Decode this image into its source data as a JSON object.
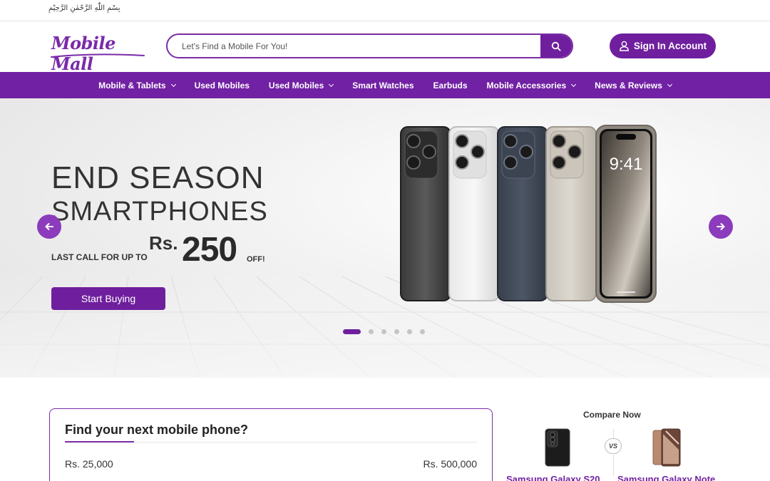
{
  "top_strip": {
    "bismillah": "بِسْمِ اللّٰهِ الرَّحْمٰنِ الرَّحِیْمِ"
  },
  "header": {
    "logo_text": "Mobile Mall",
    "search_placeholder": "Let's Find a Mobile For You!",
    "signin_label": "Sign In Account"
  },
  "nav": {
    "items": [
      {
        "label": "Mobile & Tablets",
        "has_dropdown": true
      },
      {
        "label": "Used Mobiles",
        "has_dropdown": false
      },
      {
        "label": "Used Mobiles",
        "has_dropdown": true
      },
      {
        "label": "Smart Watches",
        "has_dropdown": false
      },
      {
        "label": "Earbuds",
        "has_dropdown": false
      },
      {
        "label": "Mobile Accessories",
        "has_dropdown": true
      },
      {
        "label": "News & Reviews",
        "has_dropdown": true
      }
    ]
  },
  "hero": {
    "title_line1": "END SEASON",
    "title_line2": "SMARTPHONES",
    "subtitle": "LAST CALL FOR UP TO",
    "currency": "Rs.",
    "amount": "250",
    "off_label": "OFF!",
    "button_label": "Start Buying",
    "phone_screen_time": "9:41",
    "slides_total": 6,
    "active_slide": 1
  },
  "finder": {
    "title": "Find your next mobile phone?",
    "price_min": "Rs. 25,000",
    "price_max": "Rs. 500,000"
  },
  "compare": {
    "title": "Compare Now",
    "vs_label": "VS",
    "phone_a": "Samsung Galaxy S20",
    "phone_b": "Samsung Galaxy Note"
  },
  "colors": {
    "brand_purple": "#7121a3",
    "button_purple": "#6f1f9e",
    "arrow_purple": "#8b3bbb"
  },
  "icons": {
    "search": "search-icon",
    "user": "user-icon",
    "arrow_left": "arrow-left-icon",
    "arrow_right": "arrow-right-icon",
    "chevron": "chevron-down-icon"
  }
}
